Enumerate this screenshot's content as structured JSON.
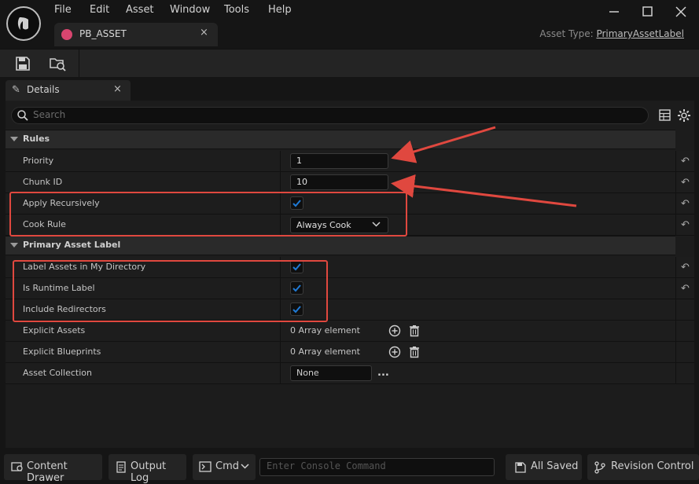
{
  "menu": [
    "File",
    "Edit",
    "Asset",
    "Window",
    "Tools",
    "Help"
  ],
  "document_tab": {
    "name": "PB_ASSET",
    "close": "×"
  },
  "asset_type": {
    "label": "Asset Type: ",
    "value": "PrimaryAssetLabel"
  },
  "details_tab": {
    "label": "Details",
    "close": "×"
  },
  "search": {
    "placeholder": "Search"
  },
  "categories": {
    "rules": "Rules",
    "primary_asset_label": "Primary Asset Label"
  },
  "properties": {
    "priority": {
      "label": "Priority",
      "value": "1"
    },
    "chunk_id": {
      "label": "Chunk ID",
      "value": "10"
    },
    "apply_recursively": {
      "label": "Apply Recursively",
      "checked": true
    },
    "cook_rule": {
      "label": "Cook Rule",
      "value": "Always Cook"
    },
    "label_assets_in_my_directory": {
      "label": "Label Assets in My Directory",
      "checked": true
    },
    "is_runtime_label": {
      "label": "Is Runtime Label",
      "checked": true
    },
    "include_redirectors": {
      "label": "Include Redirectors",
      "checked": true
    },
    "explicit_assets": {
      "label": "Explicit Assets",
      "value": "0 Array element"
    },
    "explicit_blueprints": {
      "label": "Explicit Blueprints",
      "value": "0 Array element"
    },
    "asset_collection": {
      "label": "Asset Collection",
      "value": "None"
    }
  },
  "statusbar": {
    "content_drawer": "Content Drawer",
    "output_log": "Output Log",
    "cmd": "Cmd",
    "console_placeholder": "Enter Console Command",
    "all_saved": "All Saved",
    "revision_control": "Revision Control"
  },
  "colors": {
    "accent": "#1f7ad6",
    "annotation": "#e0483f",
    "asset_icon": "#d8456f"
  }
}
